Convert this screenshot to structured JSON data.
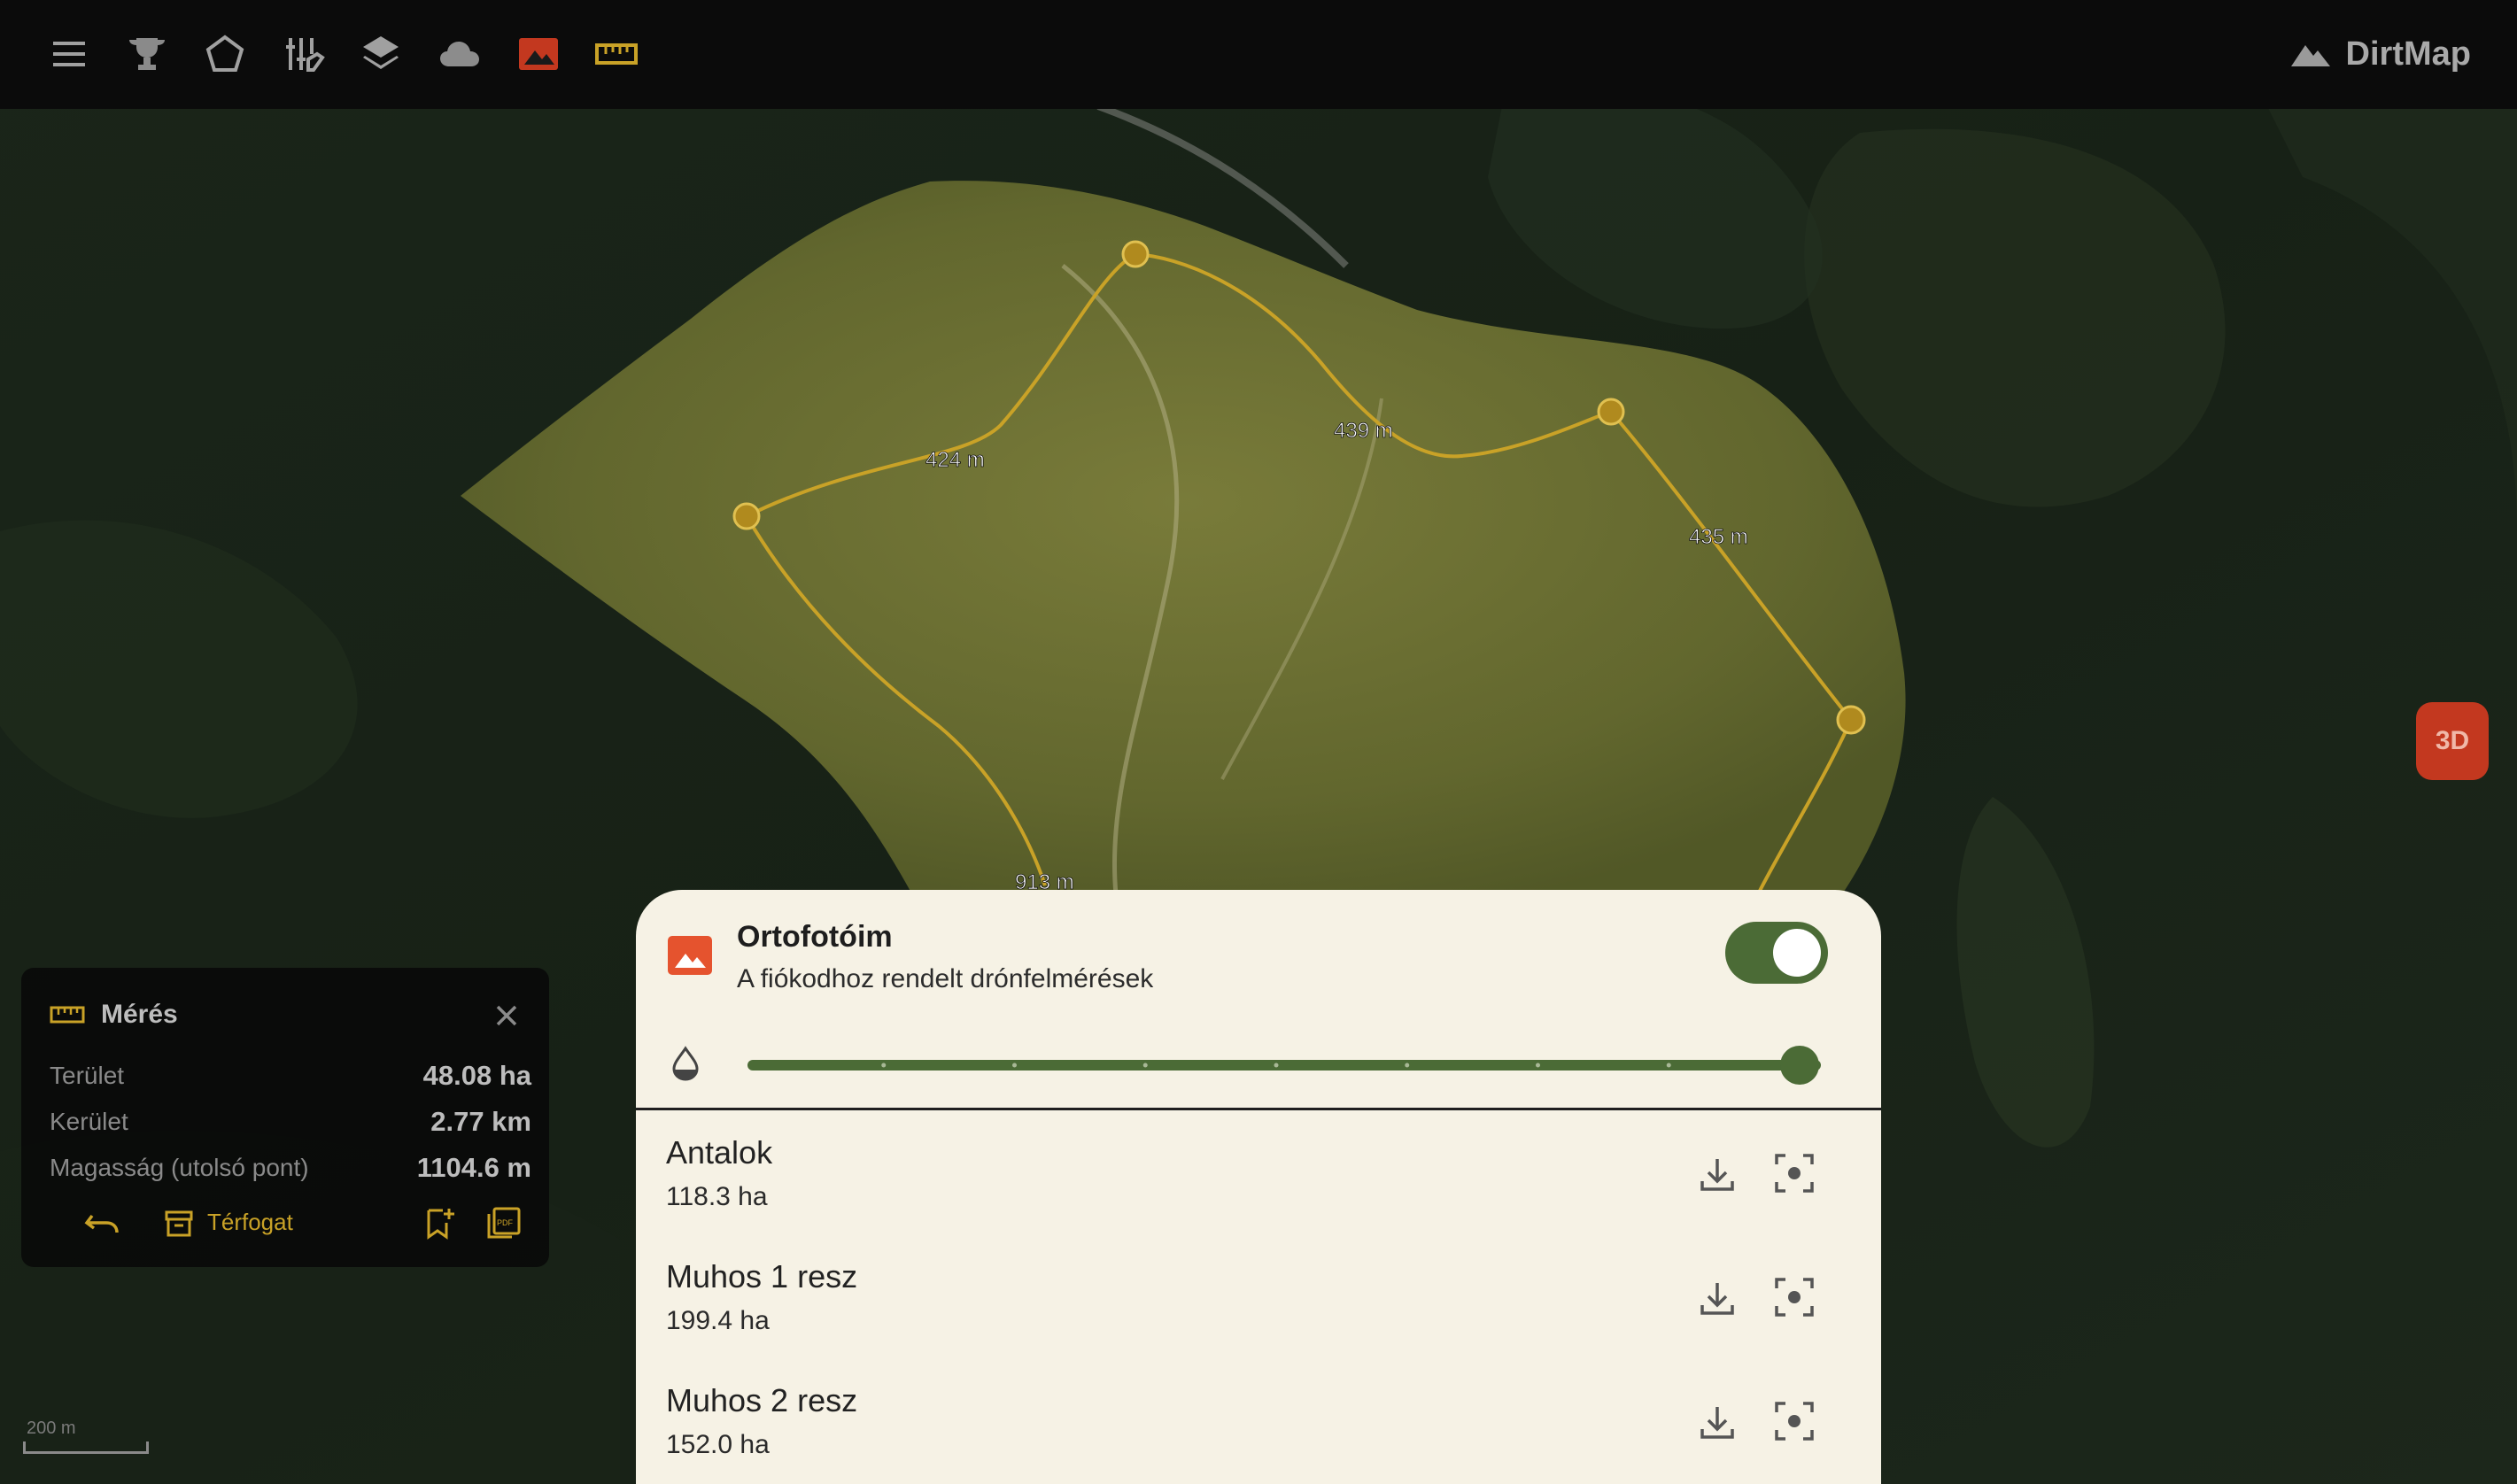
{
  "app": {
    "brand": "DirtMap"
  },
  "toolbar": {
    "items": [
      {
        "icon": "menu-icon"
      },
      {
        "icon": "trophy-icon"
      },
      {
        "icon": "pentagon-icon"
      },
      {
        "icon": "filter-icon"
      },
      {
        "icon": "layers-icon"
      },
      {
        "icon": "cloud-icon"
      },
      {
        "icon": "orthophoto-icon",
        "active": true
      },
      {
        "icon": "ruler-icon"
      }
    ]
  },
  "map": {
    "segment_labels": [
      "424 m",
      "439 m",
      "435 m",
      "913 m"
    ],
    "scale_label": "200 m",
    "btn_3d": "3D"
  },
  "measurement": {
    "title": "Mérés",
    "rows": [
      {
        "label": "Terület",
        "value": "48.08 ha"
      },
      {
        "label": "Kerület",
        "value": "2.77 km"
      },
      {
        "label": "Magasság (utolsó pont)",
        "value": "1104.6 m"
      }
    ],
    "volume_label": "Térfogat"
  },
  "sheet": {
    "title": "Ortofotóim",
    "subtitle": "A fiókodhoz rendelt drónfelmérések",
    "toggle_on": true,
    "opacity": 1.0,
    "items": [
      {
        "name": "Antalok",
        "area": "118.3 ha"
      },
      {
        "name": "Muhos 1 resz",
        "area": "199.4 ha"
      },
      {
        "name": "Muhos 2 resz",
        "area": "152.0 ha"
      }
    ]
  },
  "colors": {
    "accent": "#c9a227",
    "toggle": "#4b6b36",
    "btn3d": "#c3381f",
    "sheet_bg": "#f6f2e5",
    "topbar": "#0b0b0b"
  }
}
